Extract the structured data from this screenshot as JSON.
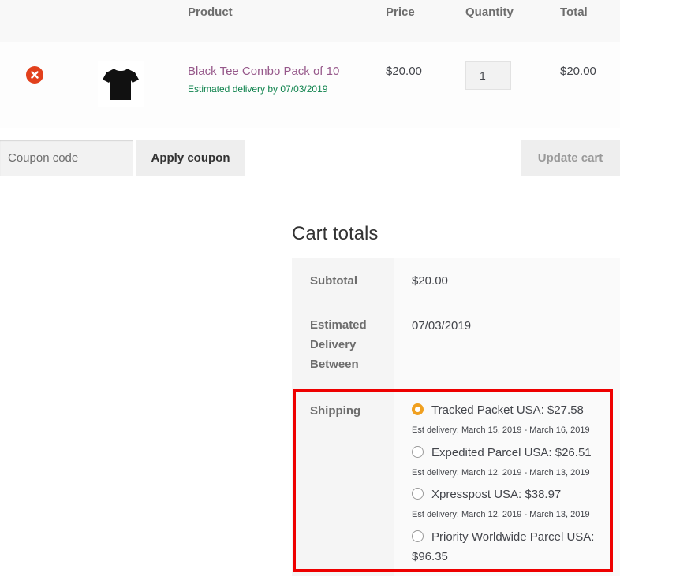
{
  "cart": {
    "headers": {
      "product": "Product",
      "price": "Price",
      "quantity": "Quantity",
      "total": "Total"
    },
    "item": {
      "name": "Black Tee Combo Pack of 10",
      "est_delivery": "Estimated delivery by 07/03/2019",
      "price": "$20.00",
      "quantity": "1",
      "total": "$20.00",
      "thumbnail_icon": "tshirt-icon",
      "remove_icon": "remove-icon"
    }
  },
  "coupon": {
    "placeholder": "Coupon code",
    "apply_label": "Apply coupon",
    "update_label": "Update cart"
  },
  "totals": {
    "title": "Cart totals",
    "subtotal_label": "Subtotal",
    "subtotal_value": "$20.00",
    "est_label_line1": "Estimated",
    "est_label_line2": "Delivery",
    "est_label_line3": "Between",
    "est_value": "07/03/2019",
    "shipping_label": "Shipping",
    "shipping_options": [
      {
        "label": "Tracked Packet USA: $27.58",
        "est": "Est delivery: March 15, 2019 - March 16, 2019",
        "selected": true
      },
      {
        "label": "Expedited Parcel USA: $26.51",
        "est": "Est delivery: March 12, 2019 - March 13, 2019",
        "selected": false
      },
      {
        "label": "Xpresspost USA: $38.97",
        "est": "Est delivery: March 12, 2019 - March 13, 2019",
        "selected": false
      },
      {
        "label_line1": "Priority Worldwide Parcel USA:",
        "label_line2": "$96.35",
        "selected": false
      }
    ]
  },
  "colors": {
    "accent_link": "#96588a",
    "delivery_green": "#0f834d",
    "remove_red": "#e2401c",
    "radio_selected": "#f0a020",
    "highlight_red": "#ee0000"
  }
}
